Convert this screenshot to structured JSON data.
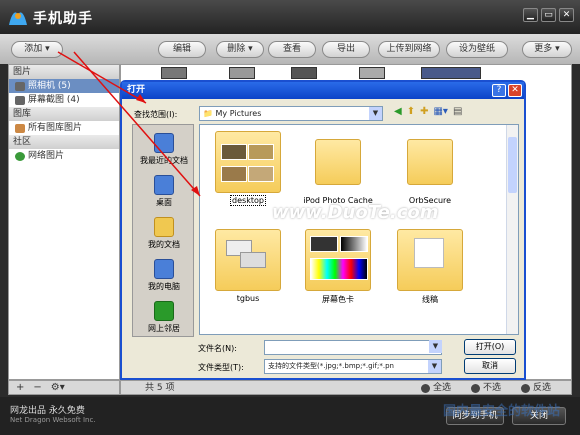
{
  "app": {
    "title": "手机助手",
    "brand_accent": "#2a6be8"
  },
  "window_controls": [
    "▁",
    "▭",
    "✕"
  ],
  "toolbar": {
    "add": "添加",
    "edit": "编辑",
    "delete": "删除",
    "view": "查看",
    "export": "导出",
    "upload": "上传到网络",
    "set_wallpaper": "设为壁纸",
    "more": "更多"
  },
  "sidebar": {
    "sections": [
      {
        "title": "图片",
        "items": [
          {
            "label": "照相机 (5)",
            "icon": "camera-icon"
          },
          {
            "label": "屏幕截图 (4)",
            "icon": "camera-icon"
          }
        ]
      },
      {
        "title": "图库",
        "items": [
          {
            "label": "所有图库图片",
            "icon": "image-icon"
          }
        ]
      },
      {
        "title": "社区",
        "items": [
          {
            "label": "网络图片",
            "icon": "globe-icon"
          }
        ]
      }
    ]
  },
  "status": {
    "count": "共 5 项",
    "select_all": "全选",
    "deselect": "不选",
    "invert": "反选"
  },
  "footer": {
    "company": "网龙出品 永久免费",
    "company_en": "Net Dragon Websoft Inc.",
    "sync": "同步到手机",
    "close": "关闭",
    "watermark": "国内最安全的软件站"
  },
  "dialog": {
    "title": "打开",
    "look_in_label": "查找范围(I):",
    "look_in_value": "My Pictures",
    "places": [
      "我最近的文档",
      "桌面",
      "我的文档",
      "我的电脑",
      "网上邻居"
    ],
    "files": [
      {
        "name": "desktop",
        "type": "thumb"
      },
      {
        "name": "iPod Photo Cache",
        "type": "plain"
      },
      {
        "name": "OrbSecure",
        "type": "plain"
      },
      {
        "name": "tgbus",
        "type": "thumb"
      },
      {
        "name": "屏幕色卡",
        "type": "thumb"
      },
      {
        "name": "线稿",
        "type": "thumb"
      }
    ],
    "filename_label": "文件名(N):",
    "filename_value": "",
    "filetype_label": "文件类型(T):",
    "filetype_value": "支持的文件类型(*.jpg;*.bmp;*.gif;*.pn",
    "open": "打开(O)",
    "cancel": "取消",
    "watermark": "www.DuoTe.com"
  }
}
